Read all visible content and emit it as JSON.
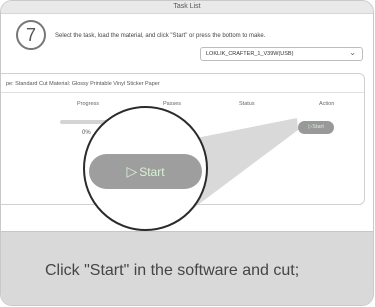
{
  "window": {
    "title": "Task List"
  },
  "step": {
    "number": "7"
  },
  "instruction": "Select the task, load the material, and click \"Start\" or press the bottom to make.",
  "device": {
    "selected": "LOKLIK_CRAFTER_1_V39W(USB)",
    "icon": "chevron-down-icon"
  },
  "task": {
    "info": "pe: Standard Cut   Material: Glossy Printable Vinyl Sticker Paper",
    "columns": [
      "Progress",
      "Passes",
      "Status",
      "Action"
    ],
    "progress_percent": "0%",
    "progress_value": 0,
    "action_label": "▷Start"
  },
  "zoom": {
    "start_label": "Start",
    "start_icon": "play-icon"
  },
  "caption": "Click \"Start\" in the software and cut;"
}
